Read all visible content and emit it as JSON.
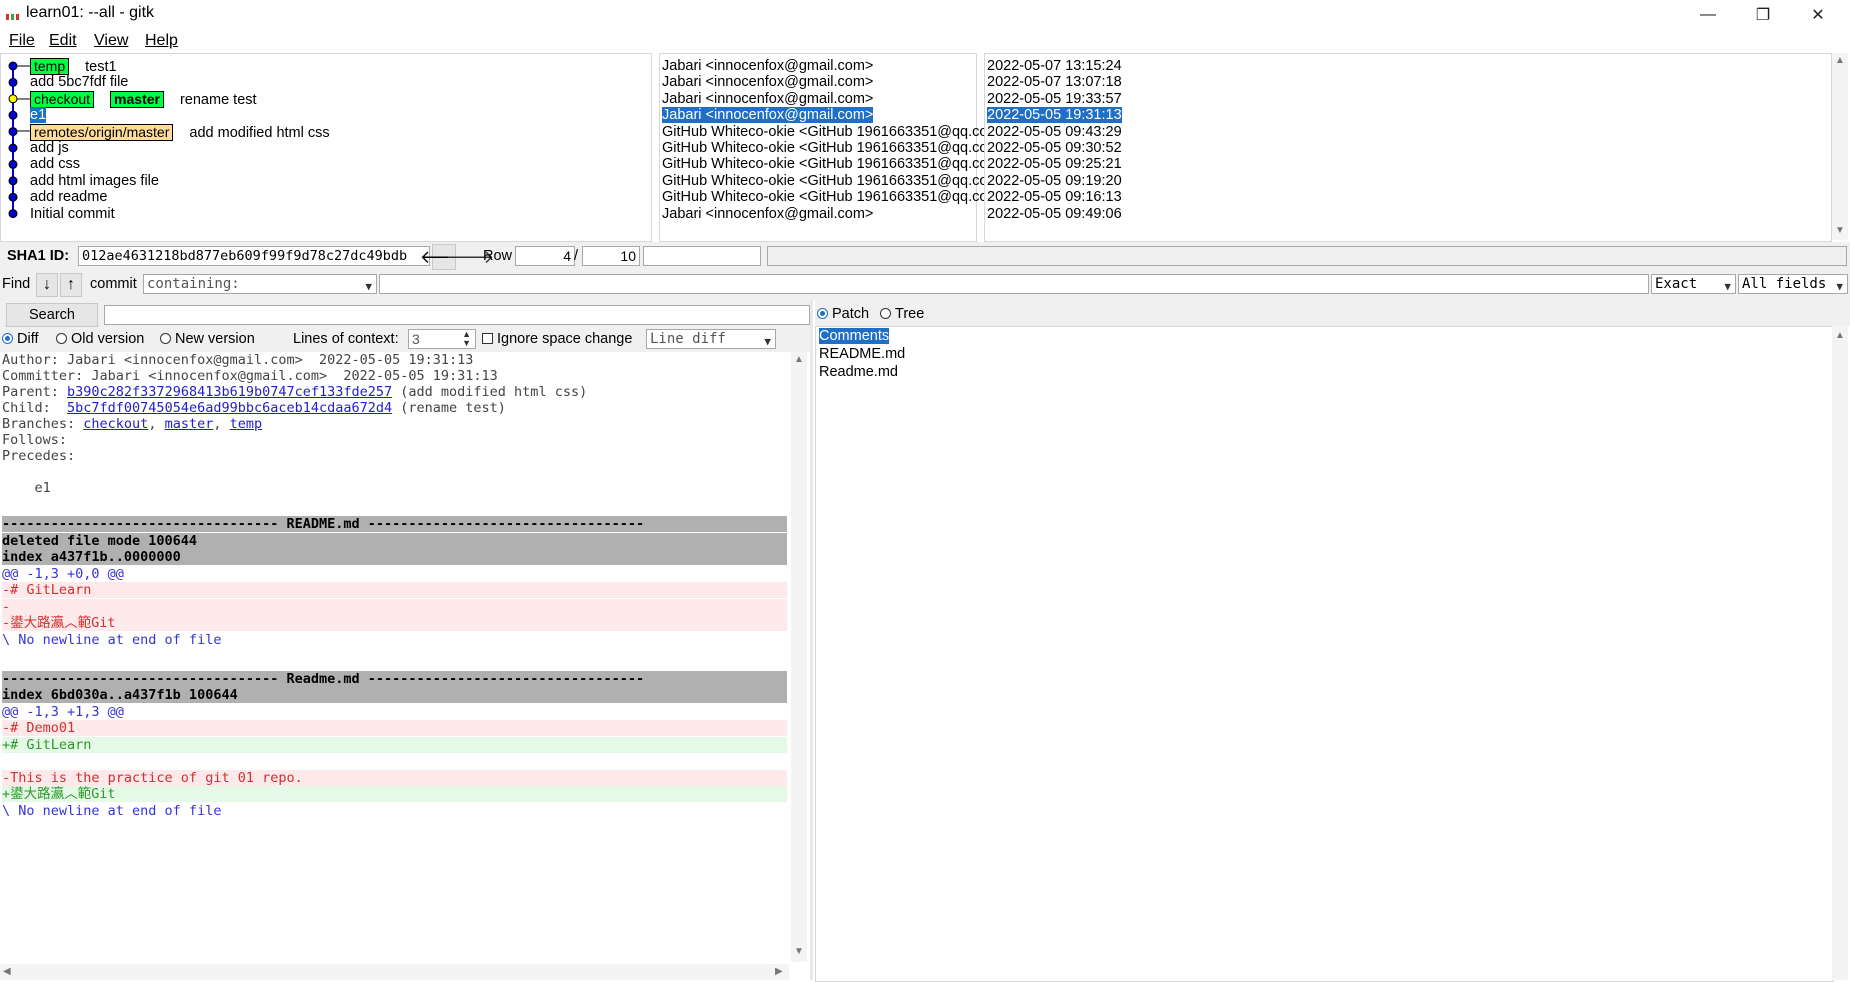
{
  "window": {
    "title": "learn01: --all - gitk",
    "minimize": "—",
    "restore": "❐",
    "close": "✕"
  },
  "menu": [
    "File",
    "Edit",
    "View",
    "Help"
  ],
  "commits": [
    {
      "refs": [
        {
          "label": "temp",
          "kind": "local"
        }
      ],
      "message": "test1",
      "author": "Jabari <innocenfox@gmail.com>",
      "date": "2022-05-07 13:15:24"
    },
    {
      "refs": [],
      "message": "add 5bc7fdf file",
      "author": "Jabari <innocenfox@gmail.com>",
      "date": "2022-05-07 13:07:18"
    },
    {
      "refs": [
        {
          "label": "checkout",
          "kind": "local"
        },
        {
          "label": "master",
          "kind": "head"
        }
      ],
      "message": "rename test",
      "author": "Jabari <innocenfox@gmail.com>",
      "date": "2022-05-05 19:33:57"
    },
    {
      "refs": [],
      "message": "e1",
      "author": "Jabari <innocenfox@gmail.com>",
      "date": "2022-05-05 19:31:13",
      "selected": true
    },
    {
      "refs": [
        {
          "label": "remotes/origin/master",
          "kind": "remote"
        }
      ],
      "message": "add modified html css",
      "author": "GitHub Whiteco-okie <GitHub 1961663351@qq.co",
      "date": "2022-05-05 09:43:29"
    },
    {
      "refs": [],
      "message": "add js",
      "author": "GitHub Whiteco-okie <GitHub 1961663351@qq.co",
      "date": "2022-05-05 09:30:52"
    },
    {
      "refs": [],
      "message": "add css",
      "author": "GitHub Whiteco-okie <GitHub 1961663351@qq.co",
      "date": "2022-05-05 09:25:21"
    },
    {
      "refs": [],
      "message": "add html images file",
      "author": "GitHub Whiteco-okie <GitHub 1961663351@qq.co",
      "date": "2022-05-05 09:19:20"
    },
    {
      "refs": [],
      "message": "add readme",
      "author": "GitHub Whiteco-okie <GitHub 1961663351@qq.co",
      "date": "2022-05-05 09:16:13"
    },
    {
      "refs": [],
      "message": "Initial commit",
      "author": "Jabari <innocenfox@gmail.com>",
      "date": "2022-05-05 09:49:06"
    }
  ],
  "sha": {
    "label": "SHA1 ID:",
    "value": "012ae4631218bd877eb609f99f9d78c27dc49bdb",
    "row_label": "Row",
    "row": "4",
    "sep": "/",
    "total": "10"
  },
  "find": {
    "label": "Find",
    "type": "commit",
    "mode": "containing:",
    "match": "Exact",
    "fields": "All fields"
  },
  "search": {
    "button": "Search"
  },
  "diff_opts": {
    "diff": "Diff",
    "old": "Old version",
    "new": "New version",
    "ctx_label": "Lines of context:",
    "ctx": "3",
    "ignore": "Ignore space change",
    "mode": "Line diff"
  },
  "right_opts": {
    "patch": "Patch",
    "tree": "Tree"
  },
  "details": {
    "author": "Author: Jabari <innocenfox@gmail.com>  2022-05-05 19:31:13",
    "committer": "Committer: Jabari <innocenfox@gmail.com>  2022-05-05 19:31:13",
    "parent_label": "Parent: ",
    "parent_sha": "b390c282f3372968413b619b0747cef133fde257",
    "parent_msg": " (add modified html css)",
    "child_label": "Child:  ",
    "child_sha": "5bc7fdf00745054e6ad99bbc6aceb14cdaa672d4",
    "child_msg": " (rename test)",
    "branches_label": "Branches: ",
    "branches": [
      "checkout",
      "master",
      "temp"
    ],
    "follows": "Follows:",
    "precedes": "Precedes:",
    "message": "    e1"
  },
  "diff_lines": [
    {
      "t": "hdr",
      "s": "---------------------------------- README.md ----------------------------------"
    },
    {
      "t": "hdr",
      "s": "deleted file mode 100644"
    },
    {
      "t": "hdr",
      "s": "index a437f1b..0000000"
    },
    {
      "t": "hunk",
      "s": "@@ -1,3 +0,0 @@"
    },
    {
      "t": "del",
      "s": "-# GitLearn"
    },
    {
      "t": "del",
      "s": "-"
    },
    {
      "t": "del",
      "s": "-鍙大路瀛︿範Git"
    },
    {
      "t": "hunk",
      "s": "\\ No newline at end of file"
    },
    {
      "t": "blank",
      "s": ""
    },
    {
      "t": "hdr",
      "s": "---------------------------------- Readme.md ----------------------------------"
    },
    {
      "t": "hdr",
      "s": "index 6bd030a..a437f1b 100644"
    },
    {
      "t": "hunk",
      "s": "@@ -1,3 +1,3 @@"
    },
    {
      "t": "del",
      "s": "-# Demo01"
    },
    {
      "t": "add",
      "s": "+# GitLearn"
    },
    {
      "t": "ctx",
      "s": " "
    },
    {
      "t": "del",
      "s": "-This is the practice of git 01 repo."
    },
    {
      "t": "add",
      "s": "+鍙大路瀛︿範Git"
    },
    {
      "t": "hunk",
      "s": "\\ No newline at end of file"
    }
  ],
  "files": [
    "Comments",
    "README.md",
    "Readme.md"
  ],
  "colors": {
    "selection": "#1f6fc5",
    "ref_local": "#00ff40",
    "ref_remote": "#ffdd99",
    "node": "#0000cc",
    "head_node": "#ffff00"
  }
}
